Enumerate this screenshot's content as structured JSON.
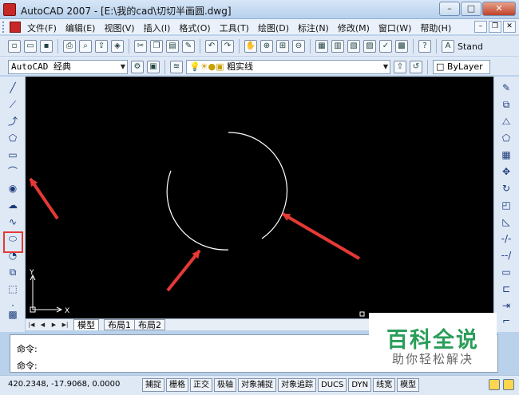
{
  "window": {
    "title": "AutoCAD 2007 - [E:\\我的cad\\切切半画圆.dwg]"
  },
  "menu": {
    "items": [
      "文件(F)",
      "编辑(E)",
      "视图(V)",
      "插入(I)",
      "格式(O)",
      "工具(T)",
      "绘图(D)",
      "标注(N)",
      "修改(M)",
      "窗口(W)",
      "帮助(H)"
    ]
  },
  "toolbar": {
    "text_style_label": "Stand",
    "workspace": "AutoCAD 经典",
    "layer_name": "粗实线",
    "color": "ByLayer"
  },
  "canvas": {
    "background": "#000000",
    "arc_color": "#ffffff",
    "ucs_y": "Y",
    "ucs_x": "X"
  },
  "tabs": {
    "items": [
      "模型",
      "布局1",
      "布局2"
    ],
    "active": "模型"
  },
  "command": {
    "lines": [
      "命令:",
      "命令:"
    ]
  },
  "status": {
    "coordinates": "420.2348, -17.9068, 0.0000",
    "buttons": [
      "捕捉",
      "栅格",
      "正交",
      "极轴",
      "对象捕捉",
      "对象追踪",
      "DUCS",
      "DYN",
      "线宽",
      "模型"
    ]
  },
  "annotations": {
    "arrow_color": "#e53935",
    "highlight_color": "#e53935"
  },
  "watermark": {
    "main": "百科全说",
    "sub": "助你轻松解决"
  }
}
